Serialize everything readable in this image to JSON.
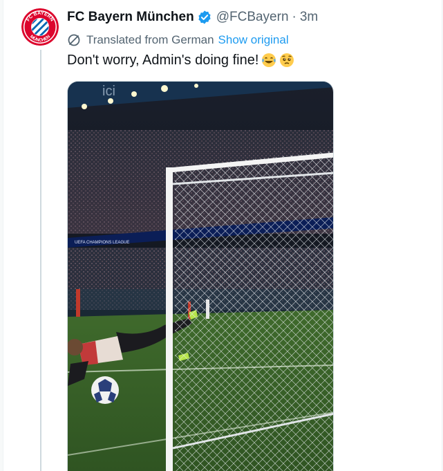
{
  "tweet": {
    "author_name": "FC Bayern München",
    "handle": "@FCBayern",
    "separator": "·",
    "time": "3m",
    "translated_label": "Translated from German",
    "show_original_label": "Show original",
    "text": "Don't worry, Admin's doing fine!",
    "emojis": [
      "laughing-crying-emoji",
      "pleading-face-emoji"
    ]
  },
  "avatar": {
    "logo_text_top": "FC BAYERN",
    "logo_text_bottom": "MÜNCHEN",
    "colors": {
      "red": "#dc052d",
      "blue": "#0066b2",
      "white": "#ffffff"
    }
  },
  "media": {
    "banner_text": "UEFA CHAMPIONS LEAGUE",
    "icons": [
      "stadium-photo"
    ]
  },
  "colors": {
    "link": "#1d9bf0",
    "muted": "#536471",
    "verified": "#1d9bf0",
    "text": "#0f1419",
    "border": "#cfd9de"
  }
}
